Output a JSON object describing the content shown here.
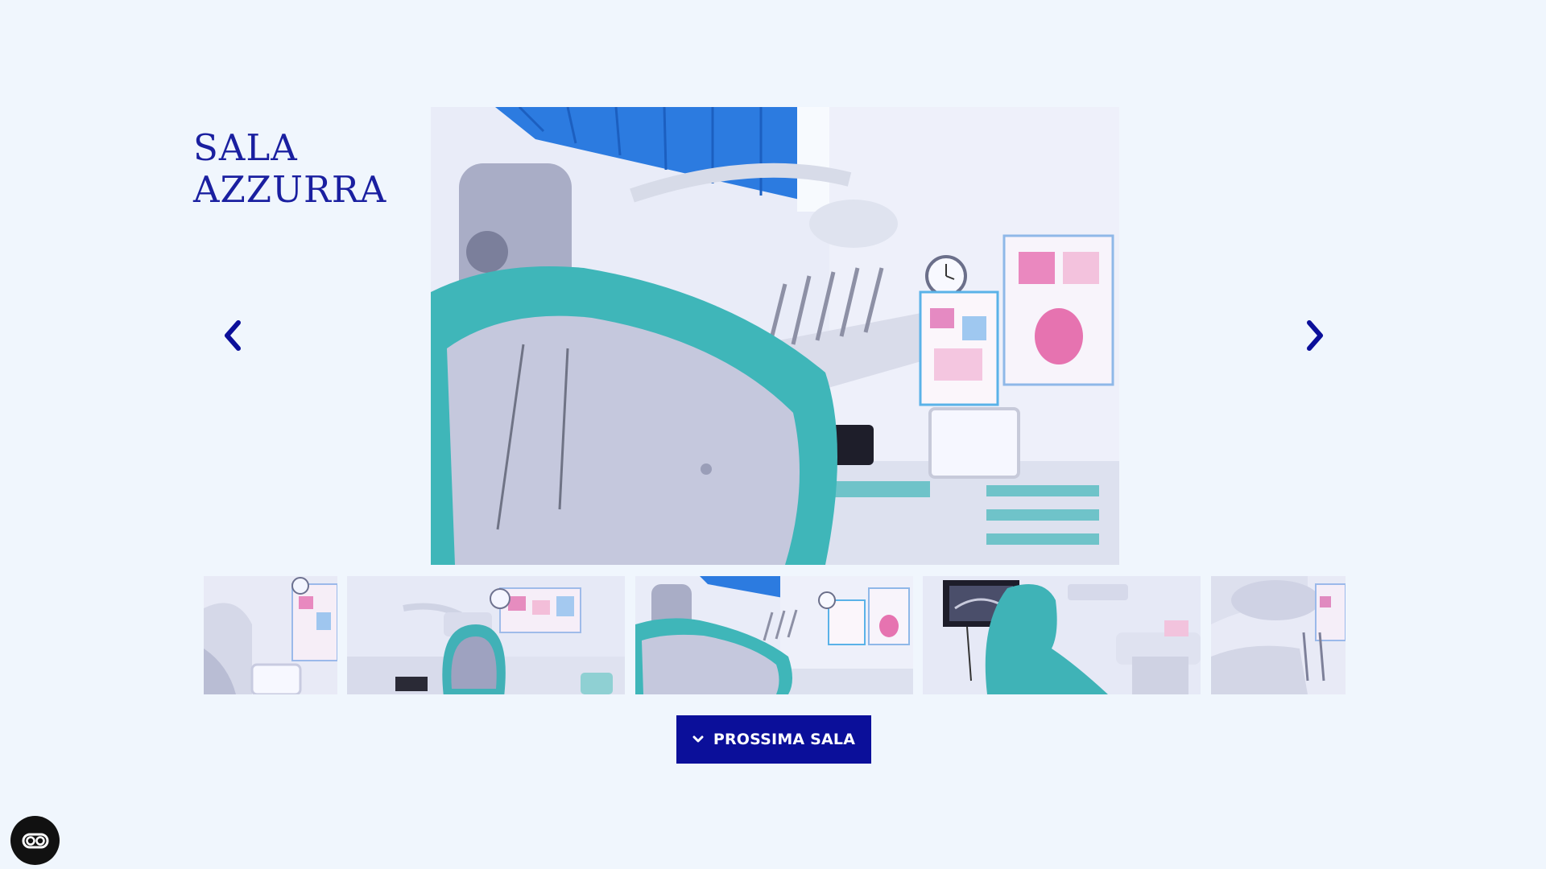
{
  "room": {
    "title_line1": "SALA",
    "title_line2": "AZZURRA"
  },
  "gallery": {
    "prev_icon": "chevron-left-icon",
    "next_icon": "chevron-right-icon",
    "main_image": "dental-chair-photo",
    "thumbnails": [
      {
        "name": "thumbnail-dental-unit"
      },
      {
        "name": "thumbnail-room-overview"
      },
      {
        "name": "thumbnail-chair-back"
      },
      {
        "name": "thumbnail-chair-xray-screen"
      },
      {
        "name": "thumbnail-dental-lamp"
      }
    ]
  },
  "actions": {
    "next_room_label": "PROSSIMA SALA",
    "next_room_icon": "chevron-down-icon"
  },
  "accessibility": {
    "icon": "accessibility-toggle-icon"
  },
  "colors": {
    "background": "#f0f6fd",
    "accent": "#0b0f9a",
    "title": "#1a1fa0"
  }
}
